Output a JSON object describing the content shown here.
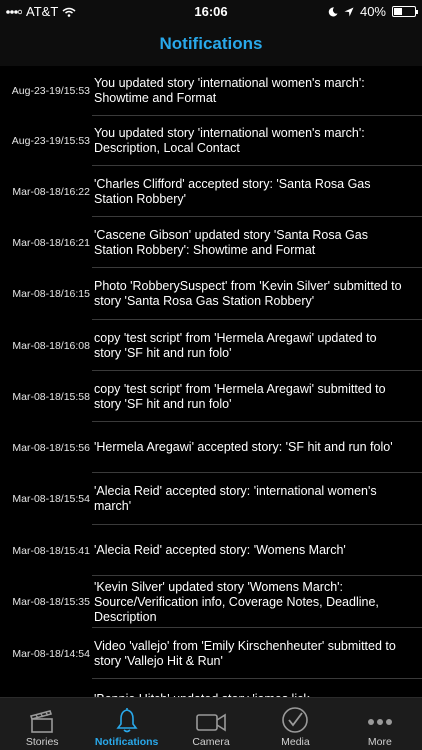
{
  "status": {
    "carrier": "AT&T",
    "time": "16:06",
    "battery": "40%",
    "battery_level": 0.4
  },
  "header": {
    "title": "Notifications"
  },
  "notifications": [
    {
      "time": "Aug-23-19/15:53",
      "text": "You updated story 'international women's march': Showtime and Format"
    },
    {
      "time": "Aug-23-19/15:53",
      "text": "You updated story 'international women's march': Description, Local Contact"
    },
    {
      "time": "Mar-08-18/16:22",
      "text": "'Charles Clifford' accepted story: 'Santa Rosa Gas Station Robbery'"
    },
    {
      "time": "Mar-08-18/16:21",
      "text": "'Cascene Gibson' updated story 'Santa Rosa Gas Station Robbery': Showtime and Format"
    },
    {
      "time": "Mar-08-18/16:15",
      "text": "Photo 'RobberySuspect' from 'Kevin Silver' submitted to story 'Santa Rosa Gas Station Robbery'"
    },
    {
      "time": "Mar-08-18/16:08",
      "text": "copy 'test script' from 'Hermela Aregawi' updated to story 'SF hit and run folo'"
    },
    {
      "time": "Mar-08-18/15:58",
      "text": "copy 'test script' from 'Hermela Aregawi' submitted to story 'SF hit and run folo'"
    },
    {
      "time": "Mar-08-18/15:56",
      "text": "'Hermela Aregawi' accepted story: 'SF hit and run folo'"
    },
    {
      "time": "Mar-08-18/15:54",
      "text": "'Alecia Reid' accepted story: 'international women's march'"
    },
    {
      "time": "Mar-08-18/15:41",
      "text": "'Alecia Reid' accepted story: 'Womens March'"
    },
    {
      "time": "Mar-08-18/15:35",
      "text": "'Kevin Silver' updated story 'Womens March': Source/Verification info, Coverage Notes, Deadline, Description"
    },
    {
      "time": "Mar-08-18/14:54",
      "text": "Video 'vallejo' from 'Emily Kirschenheuter' submitted to story 'Vallejo Hit & Run'"
    },
    {
      "time": "",
      "text": "'Bonnie Hitch' updated story 'james lick"
    }
  ],
  "tabs": [
    {
      "label": "Stories",
      "icon": "clapperboard-icon"
    },
    {
      "label": "Notifications",
      "icon": "bell-icon",
      "active": true
    },
    {
      "label": "Camera",
      "icon": "video-camera-icon"
    },
    {
      "label": "Media",
      "icon": "checkmark-circle-icon"
    },
    {
      "label": "More",
      "icon": "more-dots-icon"
    }
  ],
  "colors": {
    "accent": "#29a8ea",
    "background": "#000000",
    "tab_bar": "#1c1c1c"
  }
}
